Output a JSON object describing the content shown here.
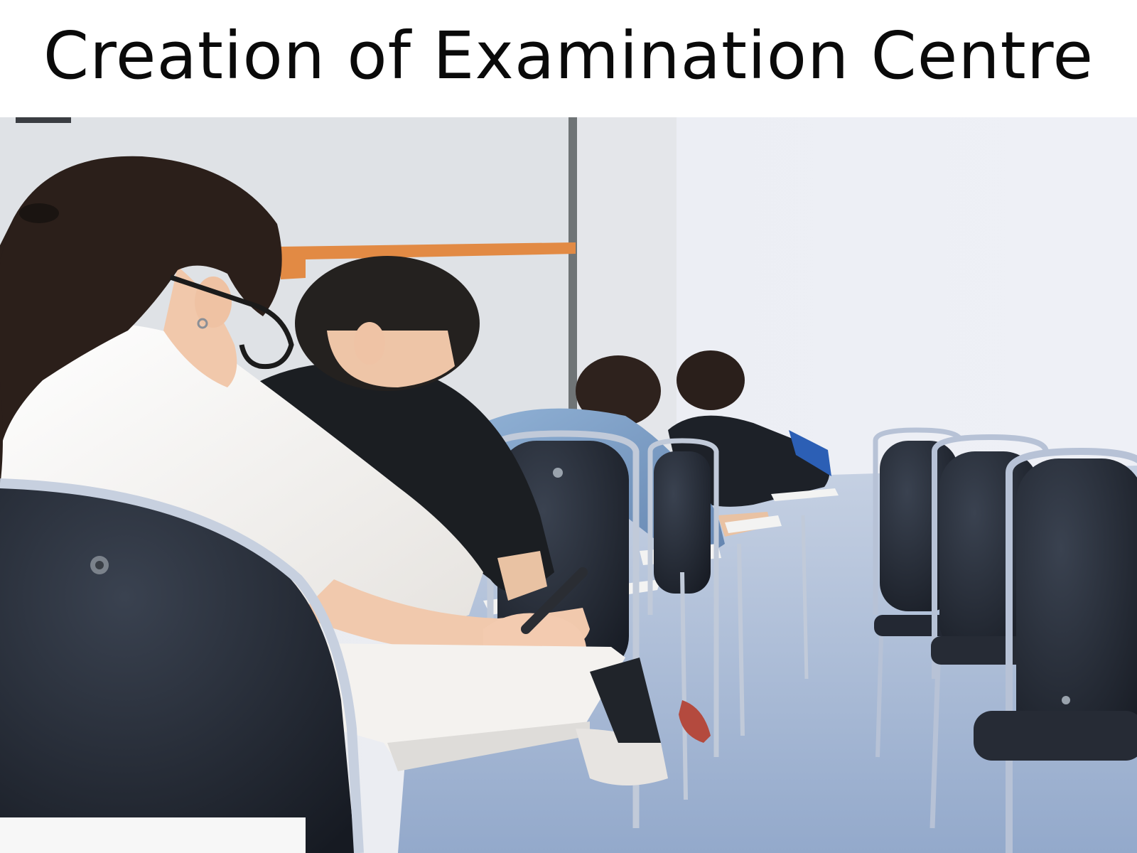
{
  "header": {
    "title": "Creation of Examination Centre"
  },
  "photo": {
    "subject": "",
    "colors": {
      "wall": "#e8eaf0",
      "floor": "#9fb3d1",
      "chair": "#1f2530",
      "frame": "#b7c2d6",
      "shirt_white": "#f4f2f0",
      "shirt_dark": "#1b1e22",
      "shirt_denim": "#7d9cc2",
      "skin": "#f1c9ad",
      "hair": "#2b1f1a",
      "accent_trim": "#e28a44"
    }
  }
}
